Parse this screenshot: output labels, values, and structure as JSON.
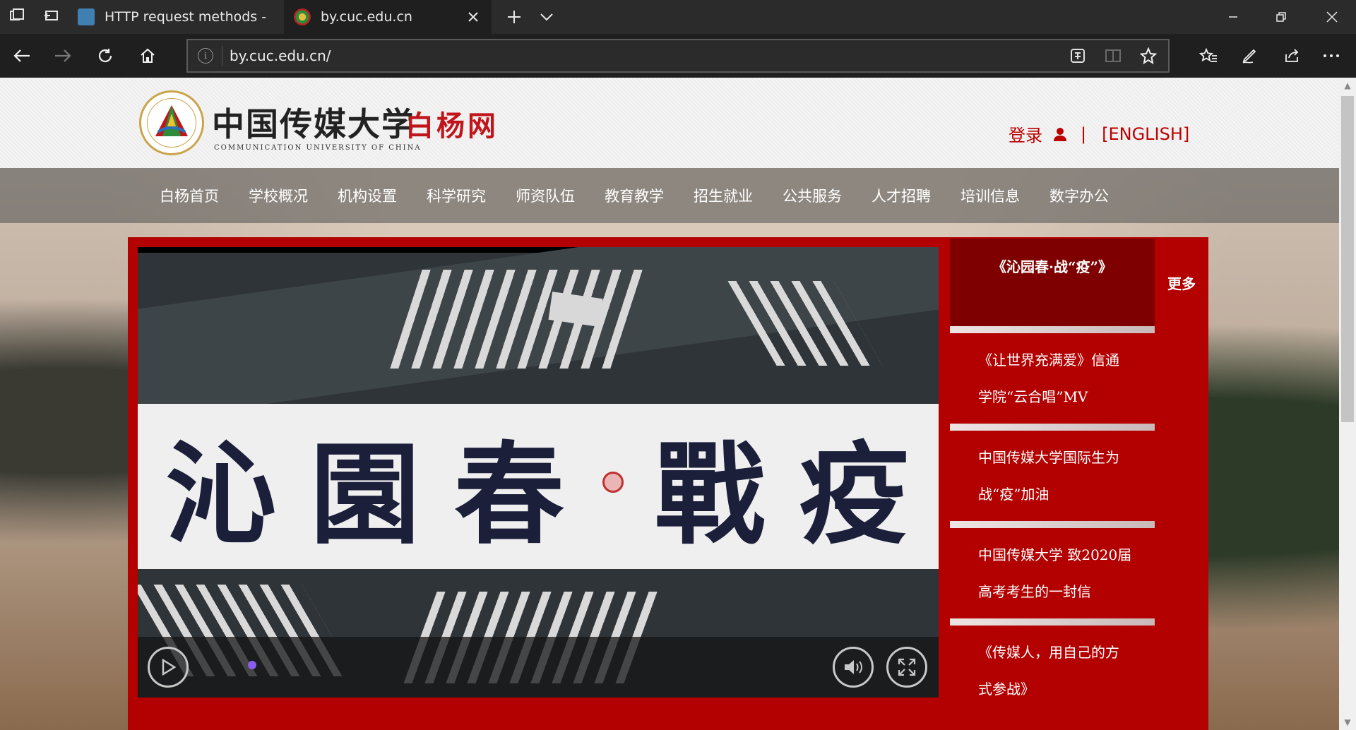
{
  "browser": {
    "tabs": [
      {
        "title": "HTTP request methods - HT",
        "active": false
      },
      {
        "title": "by.cuc.edu.cn",
        "active": true
      }
    ],
    "url": "by.cuc.edu.cn/",
    "icons": {
      "set_aside": "set-aside-tabs-icon",
      "tab_preview": "tab-preview-icon",
      "back": "back-arrow-icon",
      "forward": "forward-arrow-icon",
      "refresh": "refresh-icon",
      "home": "home-icon",
      "site_info": "info-icon",
      "read_aloud": "immersive-icon",
      "reading_view": "reading-view-icon",
      "favorite": "star-icon",
      "favorites_hub": "favorites-icon",
      "notes": "pen-icon",
      "share": "share-icon",
      "more": "more-icon"
    }
  },
  "site": {
    "logo_cn": "中国传媒大学",
    "logo_en": "COMMUNICATION UNIVERSITY OF CHINA",
    "logo_sub": "白杨网",
    "login": "登录",
    "separator": "|",
    "english": "[ENGLISH]",
    "accent": "#b30000"
  },
  "menu": [
    "白杨首页",
    "学校概况",
    "机构设置",
    "科学研究",
    "师资队伍",
    "教育教学",
    "招生就业",
    "公共服务",
    "人才招聘",
    "培训信息",
    "数字办公"
  ],
  "video": {
    "calligraphy": [
      "沁",
      "園",
      "春",
      "戰",
      "疫"
    ]
  },
  "news": {
    "featured": "《沁园春·战“疫”》",
    "more": "更多",
    "items": [
      {
        "line1": "《让世界充满爱》信通",
        "line2": "学院“云合唱”MV"
      },
      {
        "line1": "中国传媒大学国际生为",
        "line2": "战“疫”加油"
      },
      {
        "line1": "中国传媒大学 致2020届",
        "line2": "高考考生的一封信"
      },
      {
        "line1": "《传媒人，用自己的方",
        "line2": "式参战》"
      }
    ]
  }
}
